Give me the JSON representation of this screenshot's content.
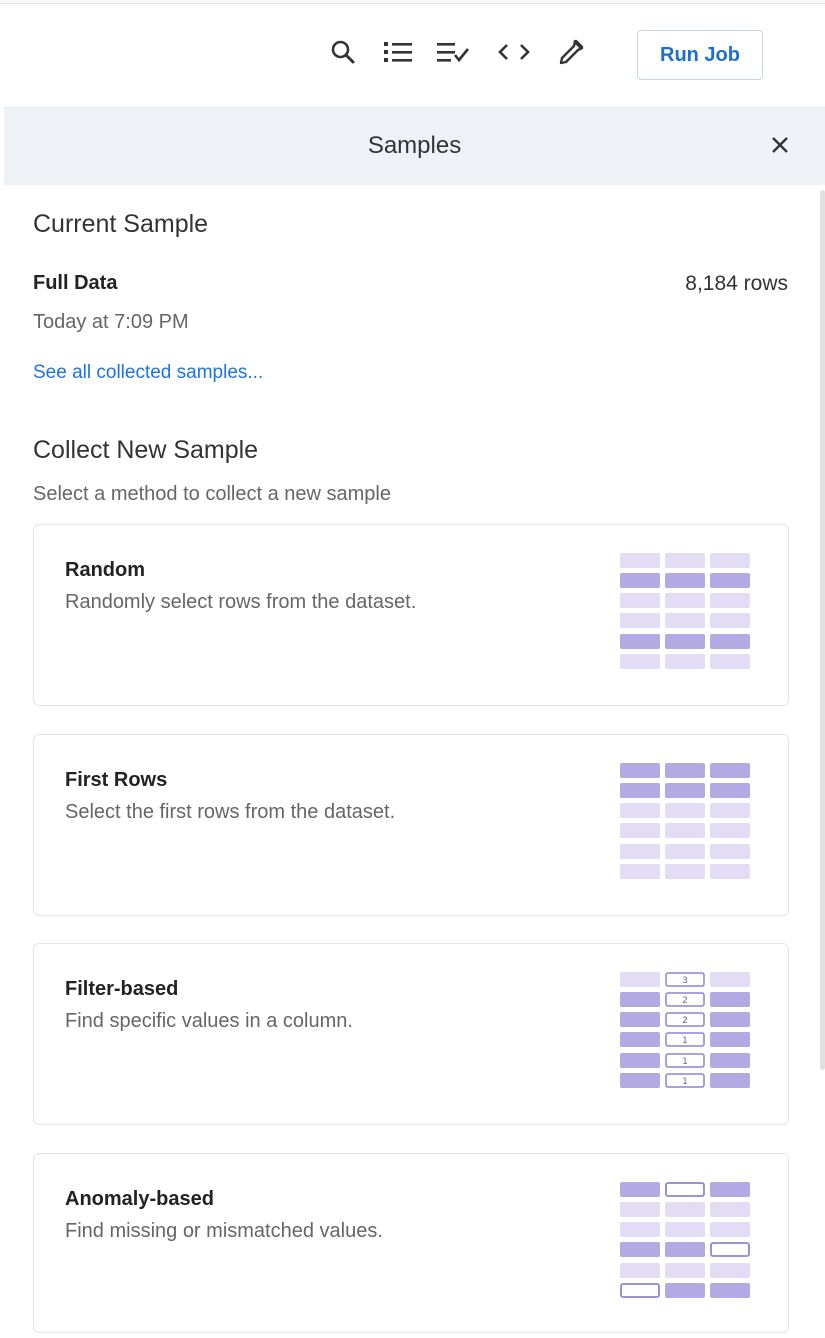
{
  "toolbar": {
    "icons": [
      "search-icon",
      "list-icon",
      "list-check-icon",
      "code-icon",
      "eyedropper-icon"
    ],
    "run_job_label": "Run Job"
  },
  "panel": {
    "title": "Samples",
    "close_icon": "close-icon"
  },
  "current_sample": {
    "heading": "Current Sample",
    "name": "Full Data",
    "rows": "8,184 rows",
    "time": "Today at 7:09 PM",
    "see_all_link": "See all collected samples..."
  },
  "collect_new": {
    "heading": "Collect New Sample",
    "subtitle": "Select a method to collect a new sample",
    "methods": [
      {
        "title": "Random",
        "description": "Randomly select rows from the dataset."
      },
      {
        "title": "First Rows",
        "description": "Select the first rows from the dataset."
      },
      {
        "title": "Filter-based",
        "description": "Find specific values in a column."
      },
      {
        "title": "Anomaly-based",
        "description": "Find missing or mismatched values."
      }
    ]
  },
  "illustrations": {
    "filter_based_numbers": [
      "3",
      "2",
      "2",
      "1",
      "1",
      "1"
    ]
  },
  "colors": {
    "accent_link": "#1a73e8",
    "illus_dark": "#b3a9e3",
    "illus_light": "#e2ddf5",
    "illus_outline": "#8e84d6"
  }
}
